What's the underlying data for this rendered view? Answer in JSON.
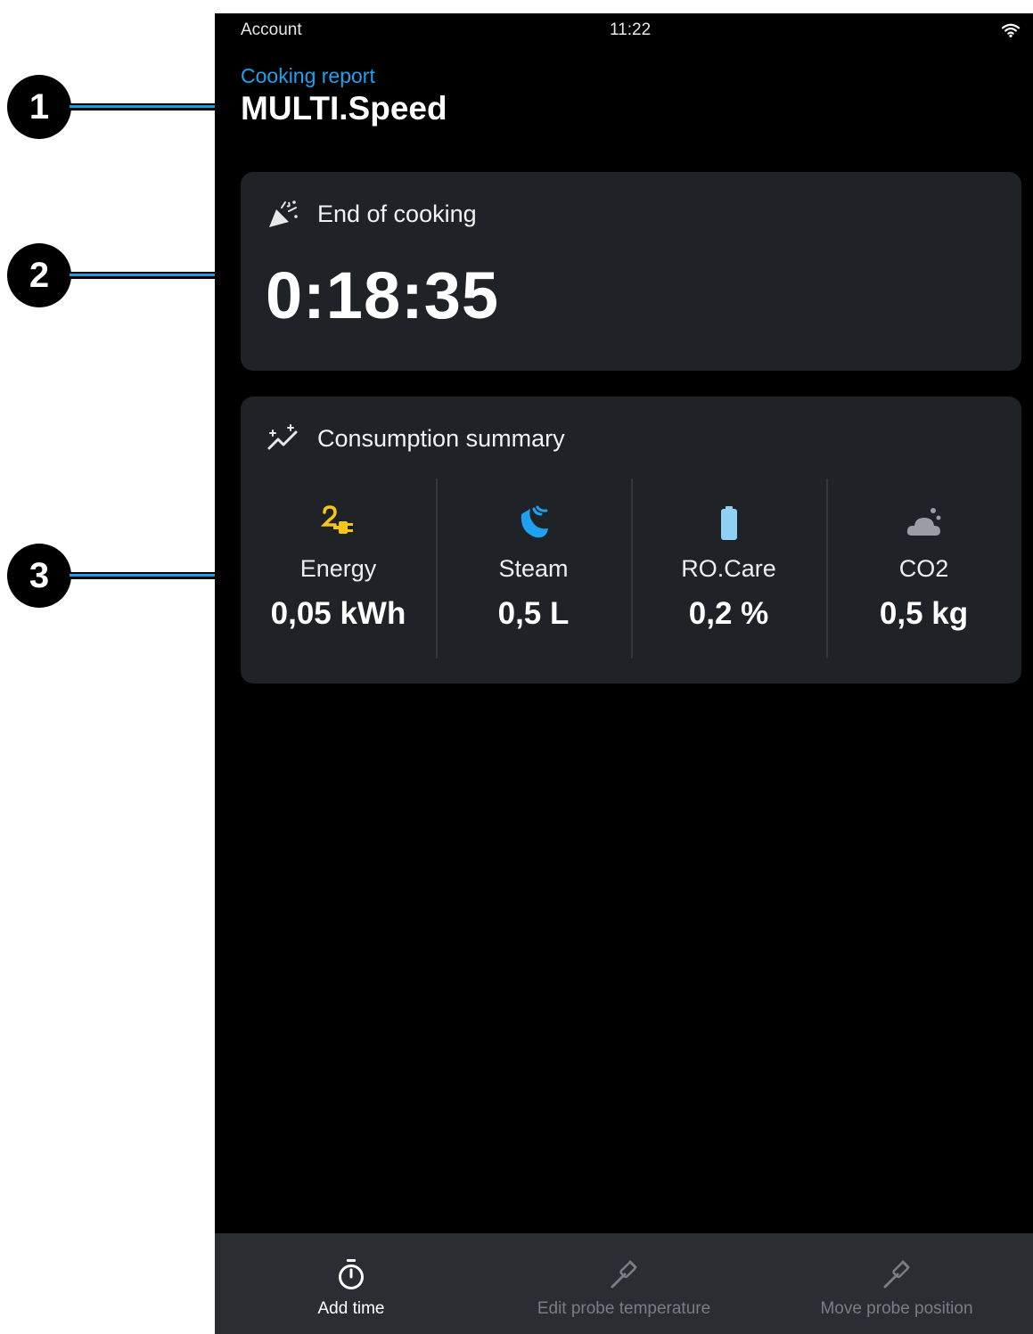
{
  "callouts": [
    "1",
    "2",
    "3"
  ],
  "status_bar": {
    "account": "Account",
    "time": "11:22",
    "wifi_icon": "wifi-icon"
  },
  "header": {
    "breadcrumb": "Cooking report",
    "title": "MULTI.Speed"
  },
  "end_of_cooking": {
    "icon": "party-popper-icon",
    "title": "End of cooking",
    "timer": "0:18:35"
  },
  "consumption": {
    "icon": "sparkle-trend-icon",
    "title": "Consumption summary",
    "metrics": [
      {
        "icon": "energy-plug-icon",
        "label": "Energy",
        "value": "0,05 kWh",
        "color": "#f5c518"
      },
      {
        "icon": "steam-icon",
        "label": "Steam",
        "value": "0,5 L",
        "color": "#1ea2f0"
      },
      {
        "icon": "battery-icon",
        "label": "RO.Care",
        "value": "0,2 %",
        "color": "#8fd0f5"
      },
      {
        "icon": "cloud-icon",
        "label": "CO2",
        "value": "0,5 kg",
        "color": "#9a9ea4"
      }
    ]
  },
  "bottom_bar": {
    "items": [
      {
        "icon": "stopwatch-icon",
        "label": "Add time",
        "state": "active"
      },
      {
        "icon": "probe-icon",
        "label": "Edit probe temperature",
        "state": "disabled"
      },
      {
        "icon": "probe-icon",
        "label": "Move probe position",
        "state": "disabled"
      }
    ]
  },
  "colors": {
    "accent": "#1ea2f0",
    "card": "#1f2226",
    "background": "#000000",
    "bottom_bar": "#2a2e33"
  }
}
